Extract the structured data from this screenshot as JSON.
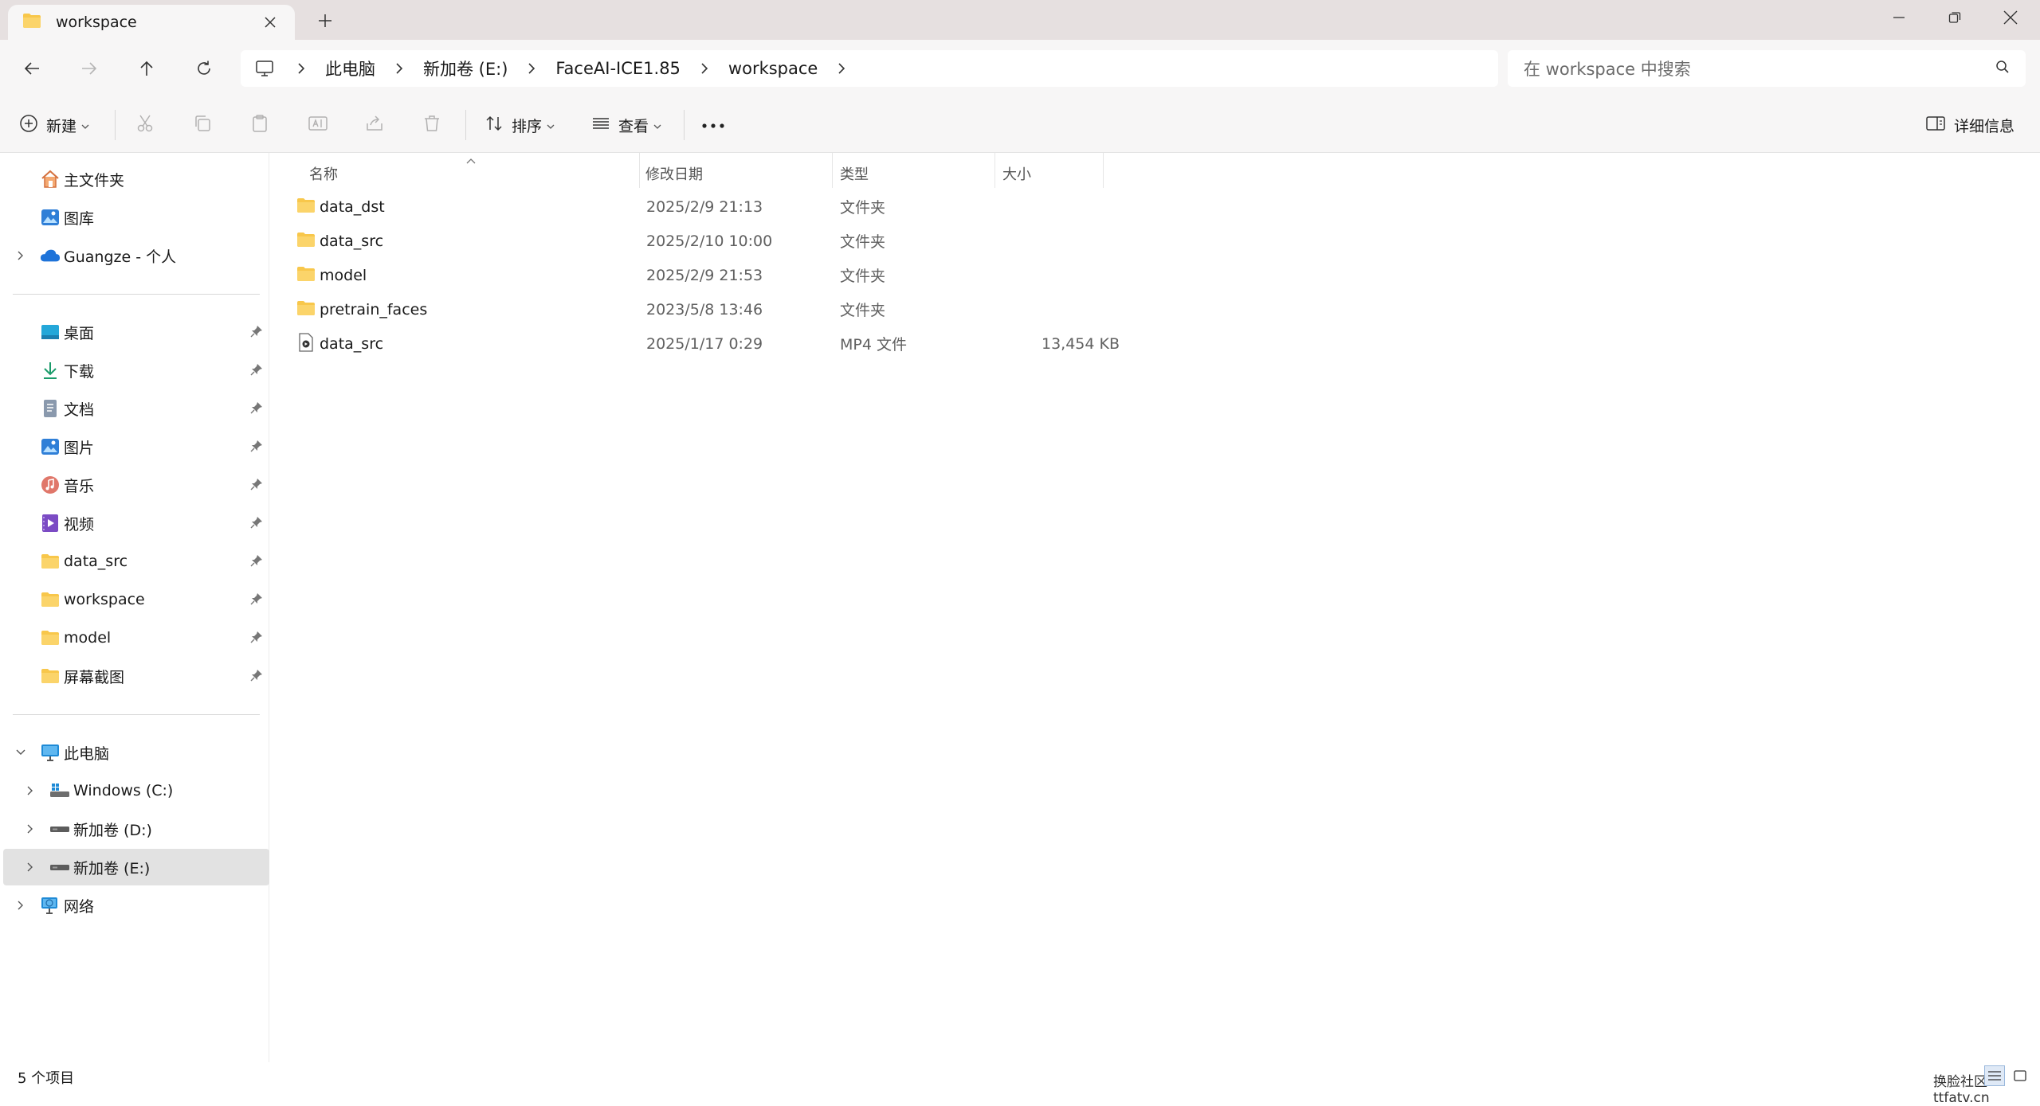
{
  "window": {
    "tab_title": "workspace"
  },
  "breadcrumb": [
    "此电脑",
    "新加卷 (E:)",
    "FaceAI-ICE1.85",
    "workspace"
  ],
  "search": {
    "placeholder": "在 workspace 中搜索"
  },
  "toolbar": {
    "new_label": "新建",
    "sort_label": "排序",
    "view_label": "查看",
    "details_label": "详细信息"
  },
  "sidebar": {
    "top": [
      {
        "label": "主文件夹",
        "icon": "home-icon"
      },
      {
        "label": "图库",
        "icon": "gallery-icon"
      },
      {
        "label": "Guangze - 个人",
        "icon": "onedrive-icon"
      }
    ],
    "quick_access": [
      {
        "label": "桌面",
        "icon": "desktop-icon"
      },
      {
        "label": "下载",
        "icon": "download-icon"
      },
      {
        "label": "文档",
        "icon": "document-icon"
      },
      {
        "label": "图片",
        "icon": "pictures-icon"
      },
      {
        "label": "音乐",
        "icon": "music-icon"
      },
      {
        "label": "视频",
        "icon": "video-icon"
      },
      {
        "label": "data_src",
        "icon": "folder-icon"
      },
      {
        "label": "workspace",
        "icon": "folder-icon"
      },
      {
        "label": "model",
        "icon": "folder-icon"
      },
      {
        "label": "屏幕截图",
        "icon": "folder-icon"
      }
    ],
    "this_pc": {
      "label": "此电脑",
      "icon": "computer-icon"
    },
    "drives": [
      {
        "label": "Windows (C:)",
        "icon": "windows-drive-icon"
      },
      {
        "label": "新加卷 (D:)",
        "icon": "drive-icon"
      },
      {
        "label": "新加卷 (E:)",
        "icon": "drive-icon",
        "selected": true
      }
    ],
    "network": {
      "label": "网络",
      "icon": "network-icon"
    }
  },
  "columns": {
    "name": "名称",
    "modified": "修改日期",
    "type": "类型",
    "size": "大小"
  },
  "files": [
    {
      "name": "data_dst",
      "modified": "2025/2/9 21:13",
      "type": "文件夹",
      "size": "",
      "icon": "folder-icon"
    },
    {
      "name": "data_src",
      "modified": "2025/2/10 10:00",
      "type": "文件夹",
      "size": "",
      "icon": "folder-icon"
    },
    {
      "name": "model",
      "modified": "2025/2/9 21:53",
      "type": "文件夹",
      "size": "",
      "icon": "folder-icon"
    },
    {
      "name": "pretrain_faces",
      "modified": "2023/5/8 13:46",
      "type": "文件夹",
      "size": "",
      "icon": "folder-icon"
    },
    {
      "name": "data_src",
      "modified": "2025/1/17 0:29",
      "type": "MP4 文件",
      "size": "13,454 KB",
      "icon": "video-file-icon"
    }
  ],
  "status": {
    "item_count": "5 个项目",
    "watermark": "换脸社区 ttfatv.cn"
  },
  "colors": {
    "folder": "#f8c74b",
    "accent": "#0067c0",
    "selected_bg": "#e2e2e2"
  }
}
